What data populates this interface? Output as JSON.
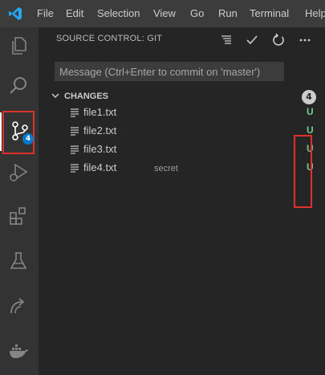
{
  "menu": {
    "items": [
      "File",
      "Edit",
      "Selection",
      "View",
      "Go",
      "Run",
      "Terminal",
      "Help"
    ]
  },
  "activity_bar": {
    "items": [
      {
        "name": "explorer",
        "icon": "files-icon"
      },
      {
        "name": "search",
        "icon": "search-icon"
      },
      {
        "name": "source-control",
        "icon": "source-control-icon",
        "badge": "4",
        "active": true
      },
      {
        "name": "run-debug",
        "icon": "run-debug-icon"
      },
      {
        "name": "extensions",
        "icon": "extensions-icon"
      },
      {
        "name": "testing",
        "icon": "flask-icon"
      },
      {
        "name": "remote",
        "icon": "remote-icon"
      },
      {
        "name": "docker",
        "icon": "docker-icon"
      }
    ]
  },
  "sidebar": {
    "title": "SOURCE CONTROL: GIT",
    "toolbar": [
      "list-icon",
      "check-icon",
      "refresh-icon",
      "more-icon"
    ],
    "message_placeholder": "Message (Ctrl+Enter to commit on 'master')",
    "changes": {
      "label": "CHANGES",
      "count": "4",
      "files": [
        {
          "name": "file1.txt",
          "description": "",
          "status": "U"
        },
        {
          "name": "file2.txt",
          "description": "",
          "status": "U"
        },
        {
          "name": "file3.txt",
          "description": "",
          "status": "U"
        },
        {
          "name": "file4.txt",
          "description": "secret",
          "status": "U"
        }
      ]
    }
  },
  "colors": {
    "untracked": "#73c991",
    "badge": "#007acc",
    "highlight": "#e0302a"
  }
}
